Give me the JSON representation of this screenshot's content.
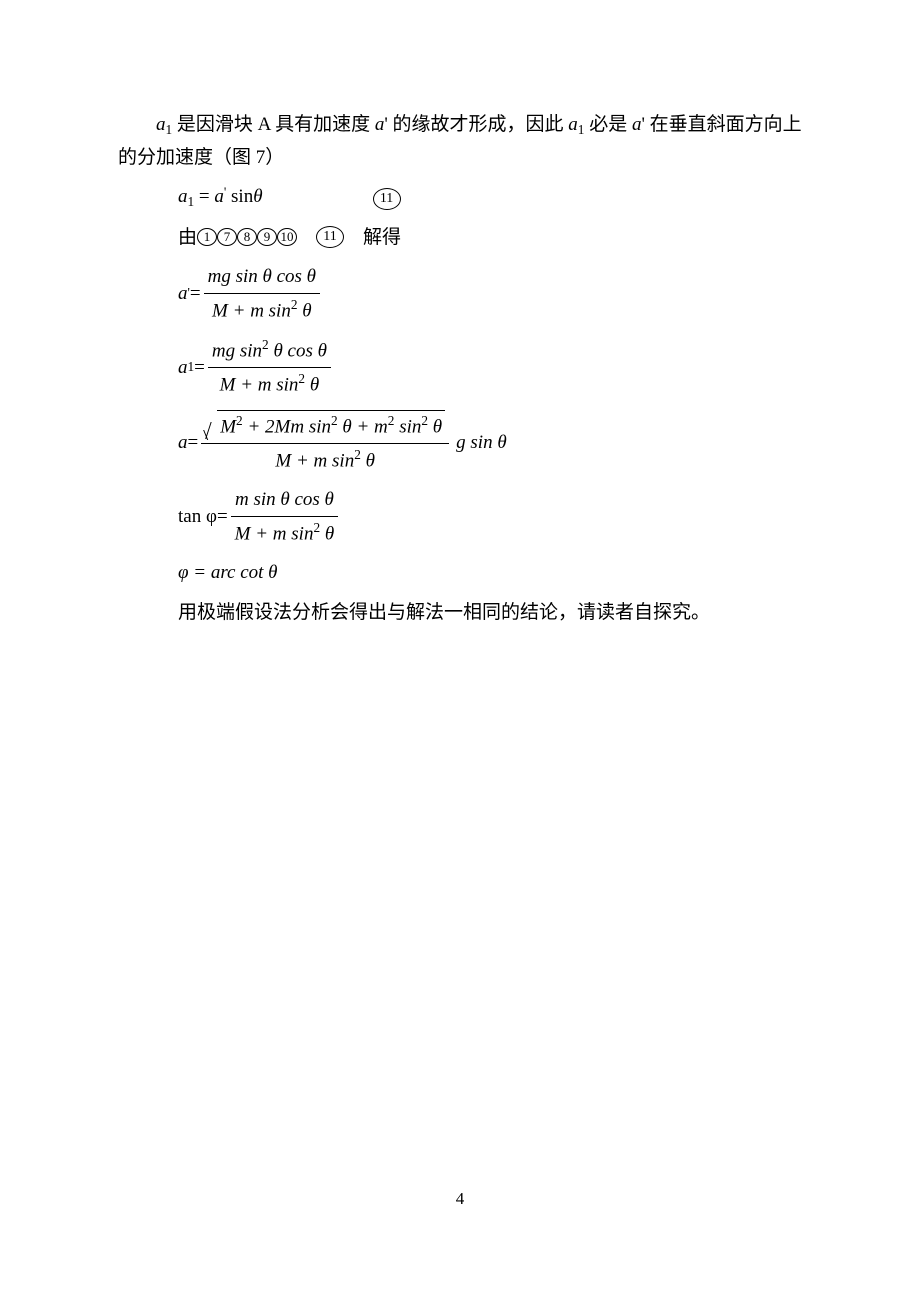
{
  "para1": {
    "a1_var": "a",
    "a1_sub": "1",
    "t1": "是因滑块 A 具有加速度",
    "ap_var": "a",
    "ap_prime": "'",
    "t2": "的缘故才形成，因此",
    "a1b_var": "a",
    "a1b_sub": "1",
    "t3": "必是",
    "apb_var": "a",
    "apb_prime": "'",
    "t4": "在垂直斜面方向上"
  },
  "para1_line2": "的分加速度（图 7）",
  "eq11": {
    "lhs_a": "a",
    "lhs_sub": "1",
    "eq": " = ",
    "rhs_a": "a",
    "rhs_prime": "'",
    "sin": " sin",
    "theta": "θ",
    "label": "11"
  },
  "line_refs": {
    "pre": "由",
    "r1": "1",
    "r7": "7",
    "r8": "8",
    "r9": "9",
    "r10": "10",
    "gap": "　",
    "r11": "11",
    "post": "　解得"
  },
  "eqA": {
    "lhs_a": "a",
    "lhs_prime": "'",
    "eq": " = ",
    "num": "mg sin θ cos θ",
    "den_pre": "M + m sin",
    "den_sup": "2",
    "den_post": " θ"
  },
  "eqB": {
    "lhs_a": "a",
    "lhs_sub": "1",
    "eq": " = ",
    "num_pre": "mg sin",
    "num_sup": "2",
    "num_post": " θ cos θ",
    "den_pre": "M + m sin",
    "den_sup": "2",
    "den_post": " θ"
  },
  "eqC": {
    "lhs": "a",
    "eq": " = ",
    "rad_1": "M",
    "rad_1s": "2",
    "rad_2a": " + 2Mm sin",
    "rad_2s": "2",
    "rad_2b": " θ + m",
    "rad_3s": "2",
    "rad_3a": " sin",
    "rad_4s": "2",
    "rad_4a": " θ",
    "den_pre": "M + m sin",
    "den_sup": "2",
    "den_post": " θ",
    "tail": " g sin θ"
  },
  "eqD": {
    "lhs": "tan φ",
    "eq": " = ",
    "num": "m sin θ cos θ",
    "den_pre": "M + m sin",
    "den_sup": "2",
    "den_post": " θ"
  },
  "eqE": {
    "text": "φ = arc cot θ"
  },
  "concl": "用极端假设法分析会得出与解法一相同的结论，请读者自探究。",
  "page_number": "4"
}
